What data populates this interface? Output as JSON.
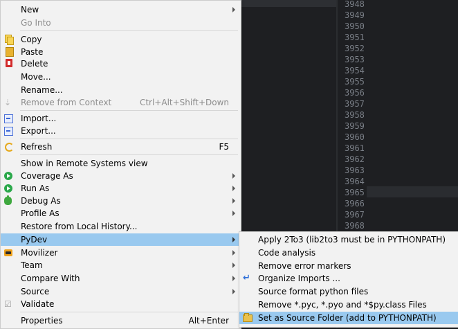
{
  "editor": {
    "line_numbers": [
      "3948",
      "3949",
      "3950",
      "3951",
      "3952",
      "3953",
      "3954",
      "3955",
      "3956",
      "3957",
      "3958",
      "3959",
      "3960",
      "3961",
      "3962",
      "3963",
      "3964",
      "3965",
      "3966",
      "3967",
      "3968"
    ]
  },
  "context_menu": {
    "items": [
      {
        "label": "New",
        "submenu": true
      },
      {
        "label": "Go Into",
        "disabled": true
      },
      {
        "label": "Copy",
        "icon": "copy-icon"
      },
      {
        "label": "Paste",
        "icon": "paste-icon"
      },
      {
        "label": "Delete",
        "icon": "delete-icon"
      },
      {
        "label": "Move..."
      },
      {
        "label": "Rename..."
      },
      {
        "label": "Remove from Context",
        "shortcut": "Ctrl+Alt+Shift+Down",
        "disabled": true,
        "icon": "remove-context-icon"
      },
      {
        "label": "Import...",
        "icon": "import-icon"
      },
      {
        "label": "Export...",
        "icon": "export-icon"
      },
      {
        "label": "Refresh",
        "shortcut": "F5",
        "icon": "refresh-icon"
      },
      {
        "label": "Show in Remote Systems view"
      },
      {
        "label": "Coverage As",
        "submenu": true,
        "icon": "coverage-icon"
      },
      {
        "label": "Run As",
        "submenu": true,
        "icon": "run-icon"
      },
      {
        "label": "Debug As",
        "submenu": true,
        "icon": "debug-icon"
      },
      {
        "label": "Profile As",
        "submenu": true
      },
      {
        "label": "Restore from Local History..."
      },
      {
        "label": "PyDev",
        "submenu": true,
        "highlighted": true
      },
      {
        "label": "Movilizer",
        "submenu": true,
        "icon": "movilizer-icon"
      },
      {
        "label": "Team",
        "submenu": true
      },
      {
        "label": "Compare With",
        "submenu": true
      },
      {
        "label": "Source",
        "submenu": true
      },
      {
        "label": "Validate",
        "icon": "validate-icon"
      },
      {
        "label": "Properties",
        "shortcut": "Alt+Enter"
      }
    ]
  },
  "pydev_submenu": {
    "items": [
      {
        "label": "Apply 2To3 (lib2to3 must be in PYTHONPATH)"
      },
      {
        "label": "Code analysis"
      },
      {
        "label": "Remove error markers"
      },
      {
        "label": "Organize Imports ...",
        "icon": "organize-imports-icon"
      },
      {
        "label": "Source format python files"
      },
      {
        "label": "Remove *.pyc, *.pyo and *$py.class Files"
      },
      {
        "label": "Set as Source Folder (add to PYTHONPATH)",
        "highlighted": true,
        "icon": "source-folder-icon"
      }
    ]
  },
  "colors": {
    "menu_bg": "#f2f2f2",
    "highlight": "#99c9ef",
    "editor_bg": "#1e1f22",
    "disabled_text": "#8d8d8d"
  }
}
